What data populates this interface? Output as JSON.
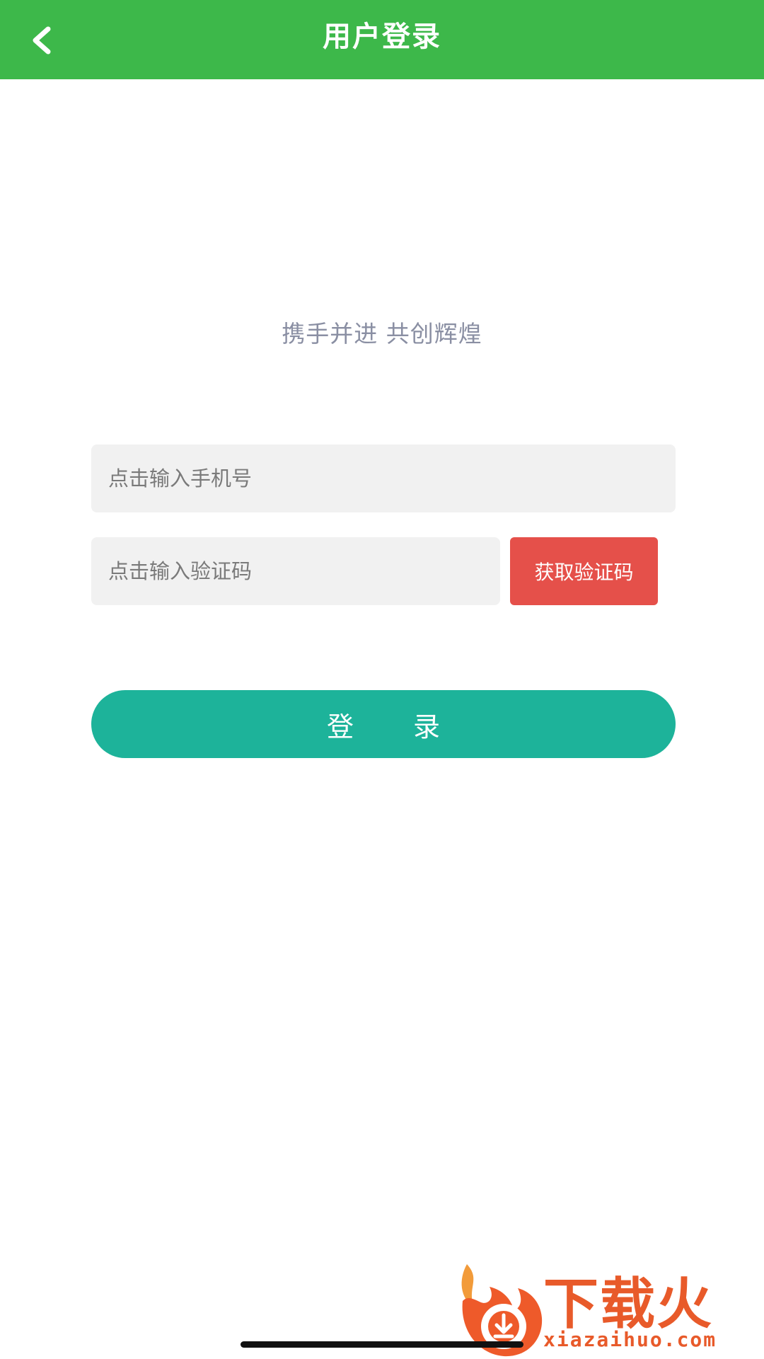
{
  "header": {
    "title": "用户登录",
    "back_icon": "chevron-left-icon",
    "background": "#3db84a"
  },
  "slogan": "携手并进 共创辉煌",
  "form": {
    "phone_placeholder": "点击输入手机号",
    "code_placeholder": "点击输入验证码",
    "get_code_label": "获取验证码",
    "login_label": "登 录"
  },
  "colors": {
    "get_code_button": "#e5504a",
    "login_button": "#1db39a",
    "input_background": "#f1f1f1"
  },
  "watermark": {
    "brand": "下载火",
    "domain": "xiazaihuo.com"
  }
}
